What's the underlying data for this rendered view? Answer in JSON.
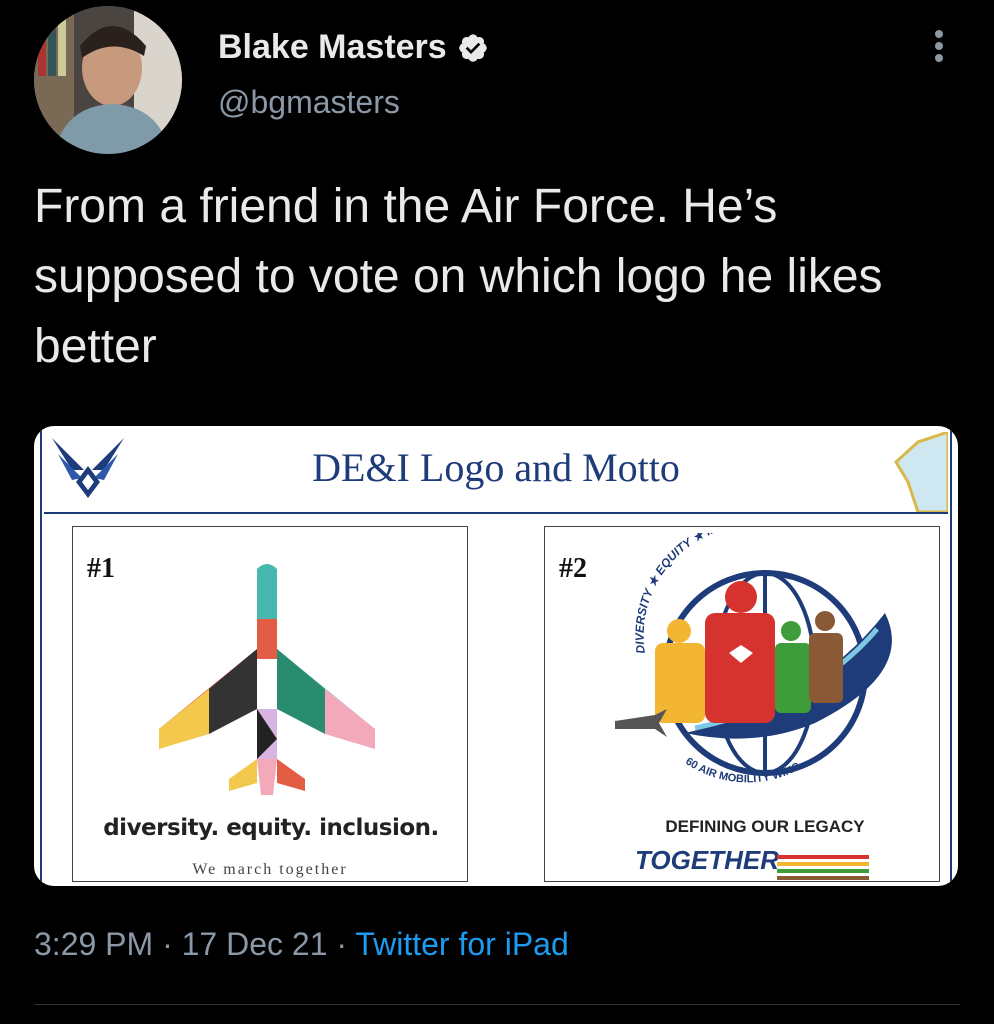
{
  "user": {
    "name": "Blake Masters",
    "handle": "@bgmasters",
    "verified": true
  },
  "tweet": {
    "text": "From a friend in the Air Force. He’s supposed to vote on which logo he likes better"
  },
  "media": {
    "title": "DE&I Logo and Motto",
    "option1": {
      "number": "#1",
      "motto": "diversity. equity. inclusion.",
      "tagline": "We march together"
    },
    "option2": {
      "number": "#2",
      "ring_text": "DIVERSITY ★ EQUITY ★ INCLUSIVE",
      "wing_text": "60 AIR MOBILITY WING",
      "legacy": "DEFINING OUR LEGACY",
      "together": "TOGETHER"
    }
  },
  "meta": {
    "time": "3:29 PM",
    "date": "17 Dec 21",
    "separator": " · ",
    "source": "Twitter for iPad"
  },
  "colors": {
    "background": "#000000",
    "text": "#e7e9ea",
    "secondary": "#8b98a5",
    "link": "#1d9bf0",
    "slide_blue": "#1f3c7a"
  }
}
